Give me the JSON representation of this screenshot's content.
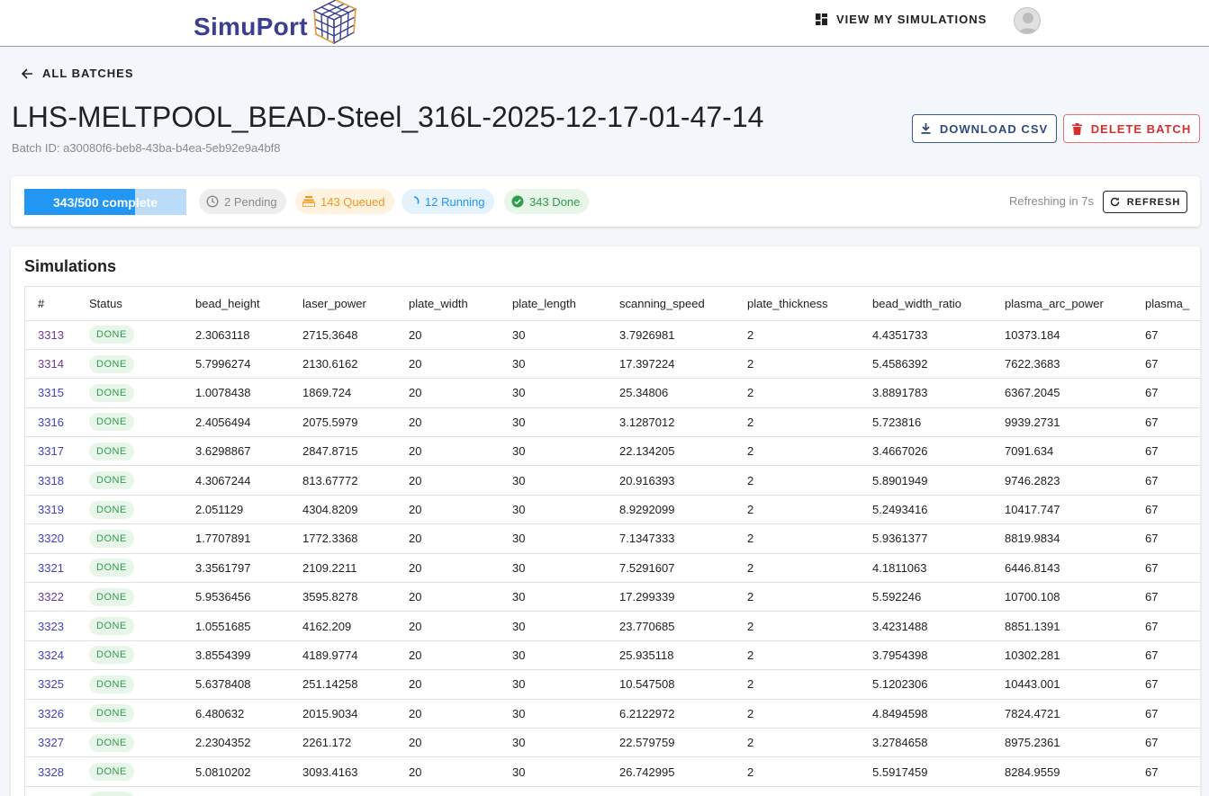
{
  "header": {
    "brand": "SimuPort",
    "nav_label": "VIEW MY SIMULATIONS"
  },
  "back_label": "ALL BATCHES",
  "batch": {
    "title": "LHS-MELTPOOL_BEAD-Steel_316L-2025-12-17-01-47-14",
    "id_line": "Batch ID: a30080f6-beb8-43ba-b4ea-5eb92e9a4bf8"
  },
  "actions": {
    "download_label": "DOWNLOAD CSV",
    "delete_label": "DELETE BATCH"
  },
  "status": {
    "progress_label": "343/500 complete",
    "progress_fraction": 0.686,
    "pending": "2 Pending",
    "queued": "143 Queued",
    "running": "12 Running",
    "done": "343 Done",
    "refresh_text": "Refreshing in 7s",
    "refresh_label": "REFRESH"
  },
  "colors": {
    "accent": "#2196f3",
    "pending": "#8a8a8a",
    "queued": "#f0961b",
    "running": "#2196f3",
    "done": "#2e9d4e",
    "delete": "#d32f2f"
  },
  "table": {
    "title": "Simulations",
    "columns": [
      "#",
      "Status",
      "bead_height",
      "laser_power",
      "plate_width",
      "plate_length",
      "scanning_speed",
      "plate_thickness",
      "bead_width_ratio",
      "plasma_arc_power",
      "plasma_"
    ],
    "rows": [
      {
        "id": "3313",
        "status": "DONE",
        "bead_height": "2.3063118",
        "laser_power": "2715.3648",
        "plate_width": "20",
        "plate_length": "30",
        "scanning_speed": "3.7926981",
        "plate_thickness": "2",
        "bead_width_ratio": "4.4351733",
        "plasma_arc_power": "10373.184",
        "plasma": "67"
      },
      {
        "id": "3314",
        "status": "DONE",
        "bead_height": "5.7996274",
        "laser_power": "2130.6162",
        "plate_width": "20",
        "plate_length": "30",
        "scanning_speed": "17.397224",
        "plate_thickness": "2",
        "bead_width_ratio": "5.4586392",
        "plasma_arc_power": "7622.3683",
        "plasma": "67"
      },
      {
        "id": "3315",
        "status": "DONE",
        "bead_height": "1.0078438",
        "laser_power": "1869.724",
        "plate_width": "20",
        "plate_length": "30",
        "scanning_speed": "25.34806",
        "plate_thickness": "2",
        "bead_width_ratio": "3.8891783",
        "plasma_arc_power": "6367.2045",
        "plasma": "67"
      },
      {
        "id": "3316",
        "status": "DONE",
        "bead_height": "2.4056494",
        "laser_power": "2075.5979",
        "plate_width": "20",
        "plate_length": "30",
        "scanning_speed": "3.1287012",
        "plate_thickness": "2",
        "bead_width_ratio": "5.723816",
        "plasma_arc_power": "9939.2731",
        "plasma": "67"
      },
      {
        "id": "3317",
        "status": "DONE",
        "bead_height": "3.6298867",
        "laser_power": "2847.8715",
        "plate_width": "20",
        "plate_length": "30",
        "scanning_speed": "22.134205",
        "plate_thickness": "2",
        "bead_width_ratio": "3.4667026",
        "plasma_arc_power": "7091.634",
        "plasma": "67"
      },
      {
        "id": "3318",
        "status": "DONE",
        "bead_height": "4.3067244",
        "laser_power": "813.67772",
        "plate_width": "20",
        "plate_length": "30",
        "scanning_speed": "20.916393",
        "plate_thickness": "2",
        "bead_width_ratio": "5.8901949",
        "plasma_arc_power": "9746.2823",
        "plasma": "67"
      },
      {
        "id": "3319",
        "status": "DONE",
        "bead_height": "2.051129",
        "laser_power": "4304.8209",
        "plate_width": "20",
        "plate_length": "30",
        "scanning_speed": "8.9292099",
        "plate_thickness": "2",
        "bead_width_ratio": "5.2493416",
        "plasma_arc_power": "10417.747",
        "plasma": "67"
      },
      {
        "id": "3320",
        "status": "DONE",
        "bead_height": "1.7707891",
        "laser_power": "1772.3368",
        "plate_width": "20",
        "plate_length": "30",
        "scanning_speed": "7.1347333",
        "plate_thickness": "2",
        "bead_width_ratio": "5.9361377",
        "plasma_arc_power": "8819.9834",
        "plasma": "67"
      },
      {
        "id": "3321",
        "status": "DONE",
        "bead_height": "3.3561797",
        "laser_power": "2109.2211",
        "plate_width": "20",
        "plate_length": "30",
        "scanning_speed": "7.5291607",
        "plate_thickness": "2",
        "bead_width_ratio": "4.1811063",
        "plasma_arc_power": "6446.8143",
        "plasma": "67"
      },
      {
        "id": "3322",
        "status": "DONE",
        "bead_height": "5.9536456",
        "laser_power": "3595.8278",
        "plate_width": "20",
        "plate_length": "30",
        "scanning_speed": "17.299339",
        "plate_thickness": "2",
        "bead_width_ratio": "5.592246",
        "plasma_arc_power": "10700.108",
        "plasma": "67"
      },
      {
        "id": "3323",
        "status": "DONE",
        "bead_height": "1.0551685",
        "laser_power": "4162.209",
        "plate_width": "20",
        "plate_length": "30",
        "scanning_speed": "23.770685",
        "plate_thickness": "2",
        "bead_width_ratio": "3.4231488",
        "plasma_arc_power": "8851.1391",
        "plasma": "67"
      },
      {
        "id": "3324",
        "status": "DONE",
        "bead_height": "3.8554399",
        "laser_power": "4189.9774",
        "plate_width": "20",
        "plate_length": "30",
        "scanning_speed": "25.935118",
        "plate_thickness": "2",
        "bead_width_ratio": "3.7954398",
        "plasma_arc_power": "10302.281",
        "plasma": "67"
      },
      {
        "id": "3325",
        "status": "DONE",
        "bead_height": "5.6378408",
        "laser_power": "251.14258",
        "plate_width": "20",
        "plate_length": "30",
        "scanning_speed": "10.547508",
        "plate_thickness": "2",
        "bead_width_ratio": "5.1202306",
        "plasma_arc_power": "10443.001",
        "plasma": "67"
      },
      {
        "id": "3326",
        "status": "DONE",
        "bead_height": "6.480632",
        "laser_power": "2015.9034",
        "plate_width": "20",
        "plate_length": "30",
        "scanning_speed": "6.2122972",
        "plate_thickness": "2",
        "bead_width_ratio": "4.8494598",
        "plasma_arc_power": "7824.4721",
        "plasma": "67"
      },
      {
        "id": "3327",
        "status": "DONE",
        "bead_height": "2.2304352",
        "laser_power": "2261.172",
        "plate_width": "20",
        "plate_length": "30",
        "scanning_speed": "22.579759",
        "plate_thickness": "2",
        "bead_width_ratio": "3.2784658",
        "plasma_arc_power": "8975.2361",
        "plasma": "67"
      },
      {
        "id": "3328",
        "status": "DONE",
        "bead_height": "5.0810202",
        "laser_power": "3093.4163",
        "plate_width": "20",
        "plate_length": "30",
        "scanning_speed": "26.742995",
        "plate_thickness": "2",
        "bead_width_ratio": "5.5917459",
        "plasma_arc_power": "8284.9559",
        "plasma": "67"
      },
      {
        "id": "",
        "status": "DONE",
        "bead_height": "",
        "laser_power": "",
        "plate_width": "",
        "plate_length": "",
        "scanning_speed": "",
        "plate_thickness": "",
        "bead_width_ratio": "",
        "plasma_arc_power": "",
        "plasma": ""
      }
    ]
  }
}
